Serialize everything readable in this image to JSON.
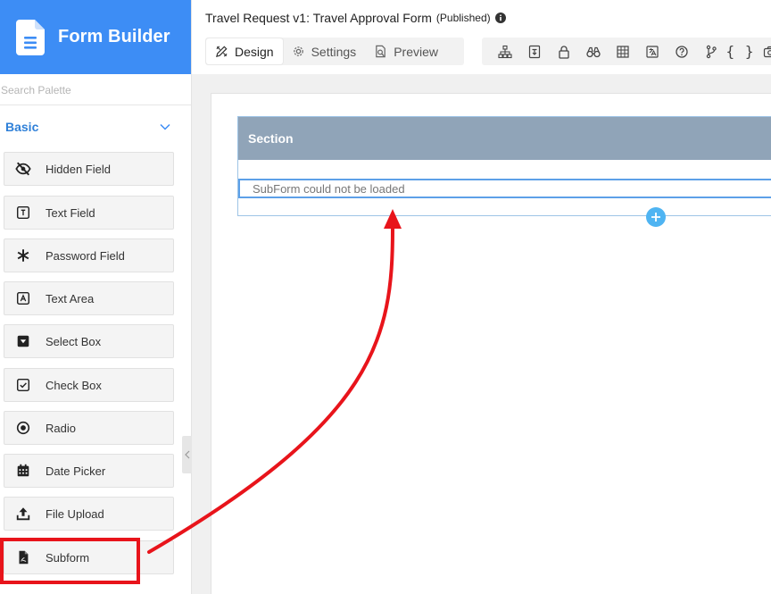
{
  "app": {
    "title": "Form Builder",
    "brand_color": "#3d8df5"
  },
  "palette": {
    "search_placeholder": "Search Palette",
    "group_label": "Basic",
    "items": [
      {
        "label": "Hidden Field",
        "icon": "eye-slash-icon"
      },
      {
        "label": "Text Field",
        "icon": "text-box-icon"
      },
      {
        "label": "Password Field",
        "icon": "asterisk-icon"
      },
      {
        "label": "Text Area",
        "icon": "text-area-icon"
      },
      {
        "label": "Select Box",
        "icon": "caret-square-icon"
      },
      {
        "label": "Check Box",
        "icon": "checkbox-icon"
      },
      {
        "label": "Radio",
        "icon": "radio-icon"
      },
      {
        "label": "Date Picker",
        "icon": "calendar-icon"
      },
      {
        "label": "File Upload",
        "icon": "upload-icon"
      },
      {
        "label": "Subform",
        "icon": "subform-file-icon"
      }
    ]
  },
  "header": {
    "form_title": "Travel Request v1: Travel Approval Form",
    "status": "(Published)",
    "tabs": [
      {
        "label": "Design",
        "icon": "pencil-ruler-icon",
        "active": true
      },
      {
        "label": "Settings",
        "icon": "gear-icon",
        "active": false
      },
      {
        "label": "Preview",
        "icon": "preview-icon",
        "active": false
      }
    ],
    "toolbar_icons": [
      "sitemap-icon",
      "save-doc-icon",
      "lock-icon",
      "binoculars-icon",
      "table-icon",
      "translate-icon",
      "question-icon",
      "branch-icon",
      "braces-icon",
      "camera-icon"
    ],
    "braces_glyph": "{ }"
  },
  "canvas": {
    "section_label": "Section",
    "section_color": "#90a4b8",
    "subform_message": "SubForm could not be loaded"
  },
  "annotation": {
    "color": "#e8141b"
  }
}
